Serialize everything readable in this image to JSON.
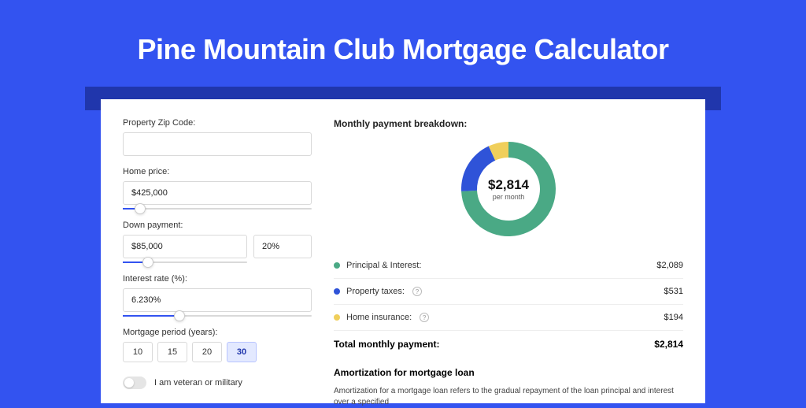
{
  "colors": {
    "primary": "#3353f0",
    "green": "#4aa985",
    "blue": "#2f53d8",
    "yellow": "#f0cf5b"
  },
  "hero": {
    "title": "Pine Mountain Club Mortgage Calculator"
  },
  "form": {
    "zip": {
      "label": "Property Zip Code:",
      "value": ""
    },
    "home_price": {
      "label": "Home price:",
      "value": "$425,000",
      "slider_pct": 9
    },
    "down_payment": {
      "label": "Down payment:",
      "amount": "$85,000",
      "pct": "20%",
      "slider_pct": 20
    },
    "interest": {
      "label": "Interest rate (%):",
      "value": "6.230%",
      "slider_pct": 30
    },
    "period": {
      "label": "Mortgage period (years):",
      "options": [
        "10",
        "15",
        "20",
        "30"
      ],
      "selected": "30"
    },
    "veteran": {
      "label": "I am veteran or military",
      "checked": false
    }
  },
  "breakdown": {
    "title": "Monthly payment breakdown:",
    "center_value": "$2,814",
    "center_sub": "per month",
    "items": [
      {
        "label": "Principal & Interest:",
        "value": "$2,089",
        "color_key": "green",
        "help": false
      },
      {
        "label": "Property taxes:",
        "value": "$531",
        "color_key": "blue",
        "help": true
      },
      {
        "label": "Home insurance:",
        "value": "$194",
        "color_key": "yellow",
        "help": true
      }
    ],
    "total_label": "Total monthly payment:",
    "total_value": "$2,814"
  },
  "chart_data": {
    "type": "pie",
    "title": "Monthly payment breakdown",
    "series": [
      {
        "name": "Principal & Interest",
        "value": 2089,
        "color": "#4aa985"
      },
      {
        "name": "Property taxes",
        "value": 531,
        "color": "#2f53d8"
      },
      {
        "name": "Home insurance",
        "value": 194,
        "color": "#f0cf5b"
      }
    ],
    "total": 2814,
    "center_label": "$2,814 per month"
  },
  "amort": {
    "title": "Amortization for mortgage loan",
    "text": "Amortization for a mortgage loan refers to the gradual repayment of the loan principal and interest over a specified"
  }
}
